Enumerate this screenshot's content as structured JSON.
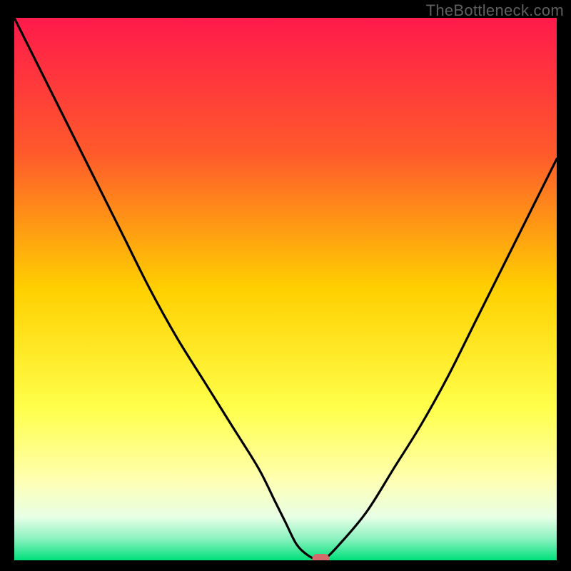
{
  "watermark": "TheBottleneck.com",
  "chart_data": {
    "type": "line",
    "title": "",
    "xlabel": "",
    "ylabel": "",
    "xlim": [
      0,
      100
    ],
    "ylim": [
      0,
      100
    ],
    "grid": false,
    "legend": null,
    "background": {
      "type": "vertical-gradient",
      "stops": [
        {
          "y": 0,
          "color": "#ff1a4b"
        },
        {
          "y": 25,
          "color": "#ff5a2b"
        },
        {
          "y": 50,
          "color": "#ffd000"
        },
        {
          "y": 72,
          "color": "#ffff4b"
        },
        {
          "y": 85,
          "color": "#ffffb0"
        },
        {
          "y": 92,
          "color": "#e8ffe6"
        },
        {
          "y": 96,
          "color": "#8cf2c0"
        },
        {
          "y": 100,
          "color": "#00e07a"
        }
      ]
    },
    "series": [
      {
        "name": "bottleneck-curve",
        "color": "#000000",
        "x": [
          0,
          5,
          10,
          15,
          20,
          25,
          30,
          35,
          40,
          45,
          48,
          50,
          52,
          54,
          56,
          57,
          60,
          65,
          70,
          75,
          80,
          85,
          90,
          95,
          100
        ],
        "y": [
          100,
          90,
          80,
          70,
          60,
          50,
          41,
          33,
          25,
          17,
          11,
          7,
          3,
          1,
          0,
          0,
          3,
          9,
          17,
          25,
          34,
          44,
          54,
          64,
          74
        ]
      }
    ],
    "markers": [
      {
        "name": "optimum-marker",
        "shape": "rounded-rect",
        "x": 56.5,
        "y": 0,
        "color": "#d36a6a"
      }
    ]
  }
}
